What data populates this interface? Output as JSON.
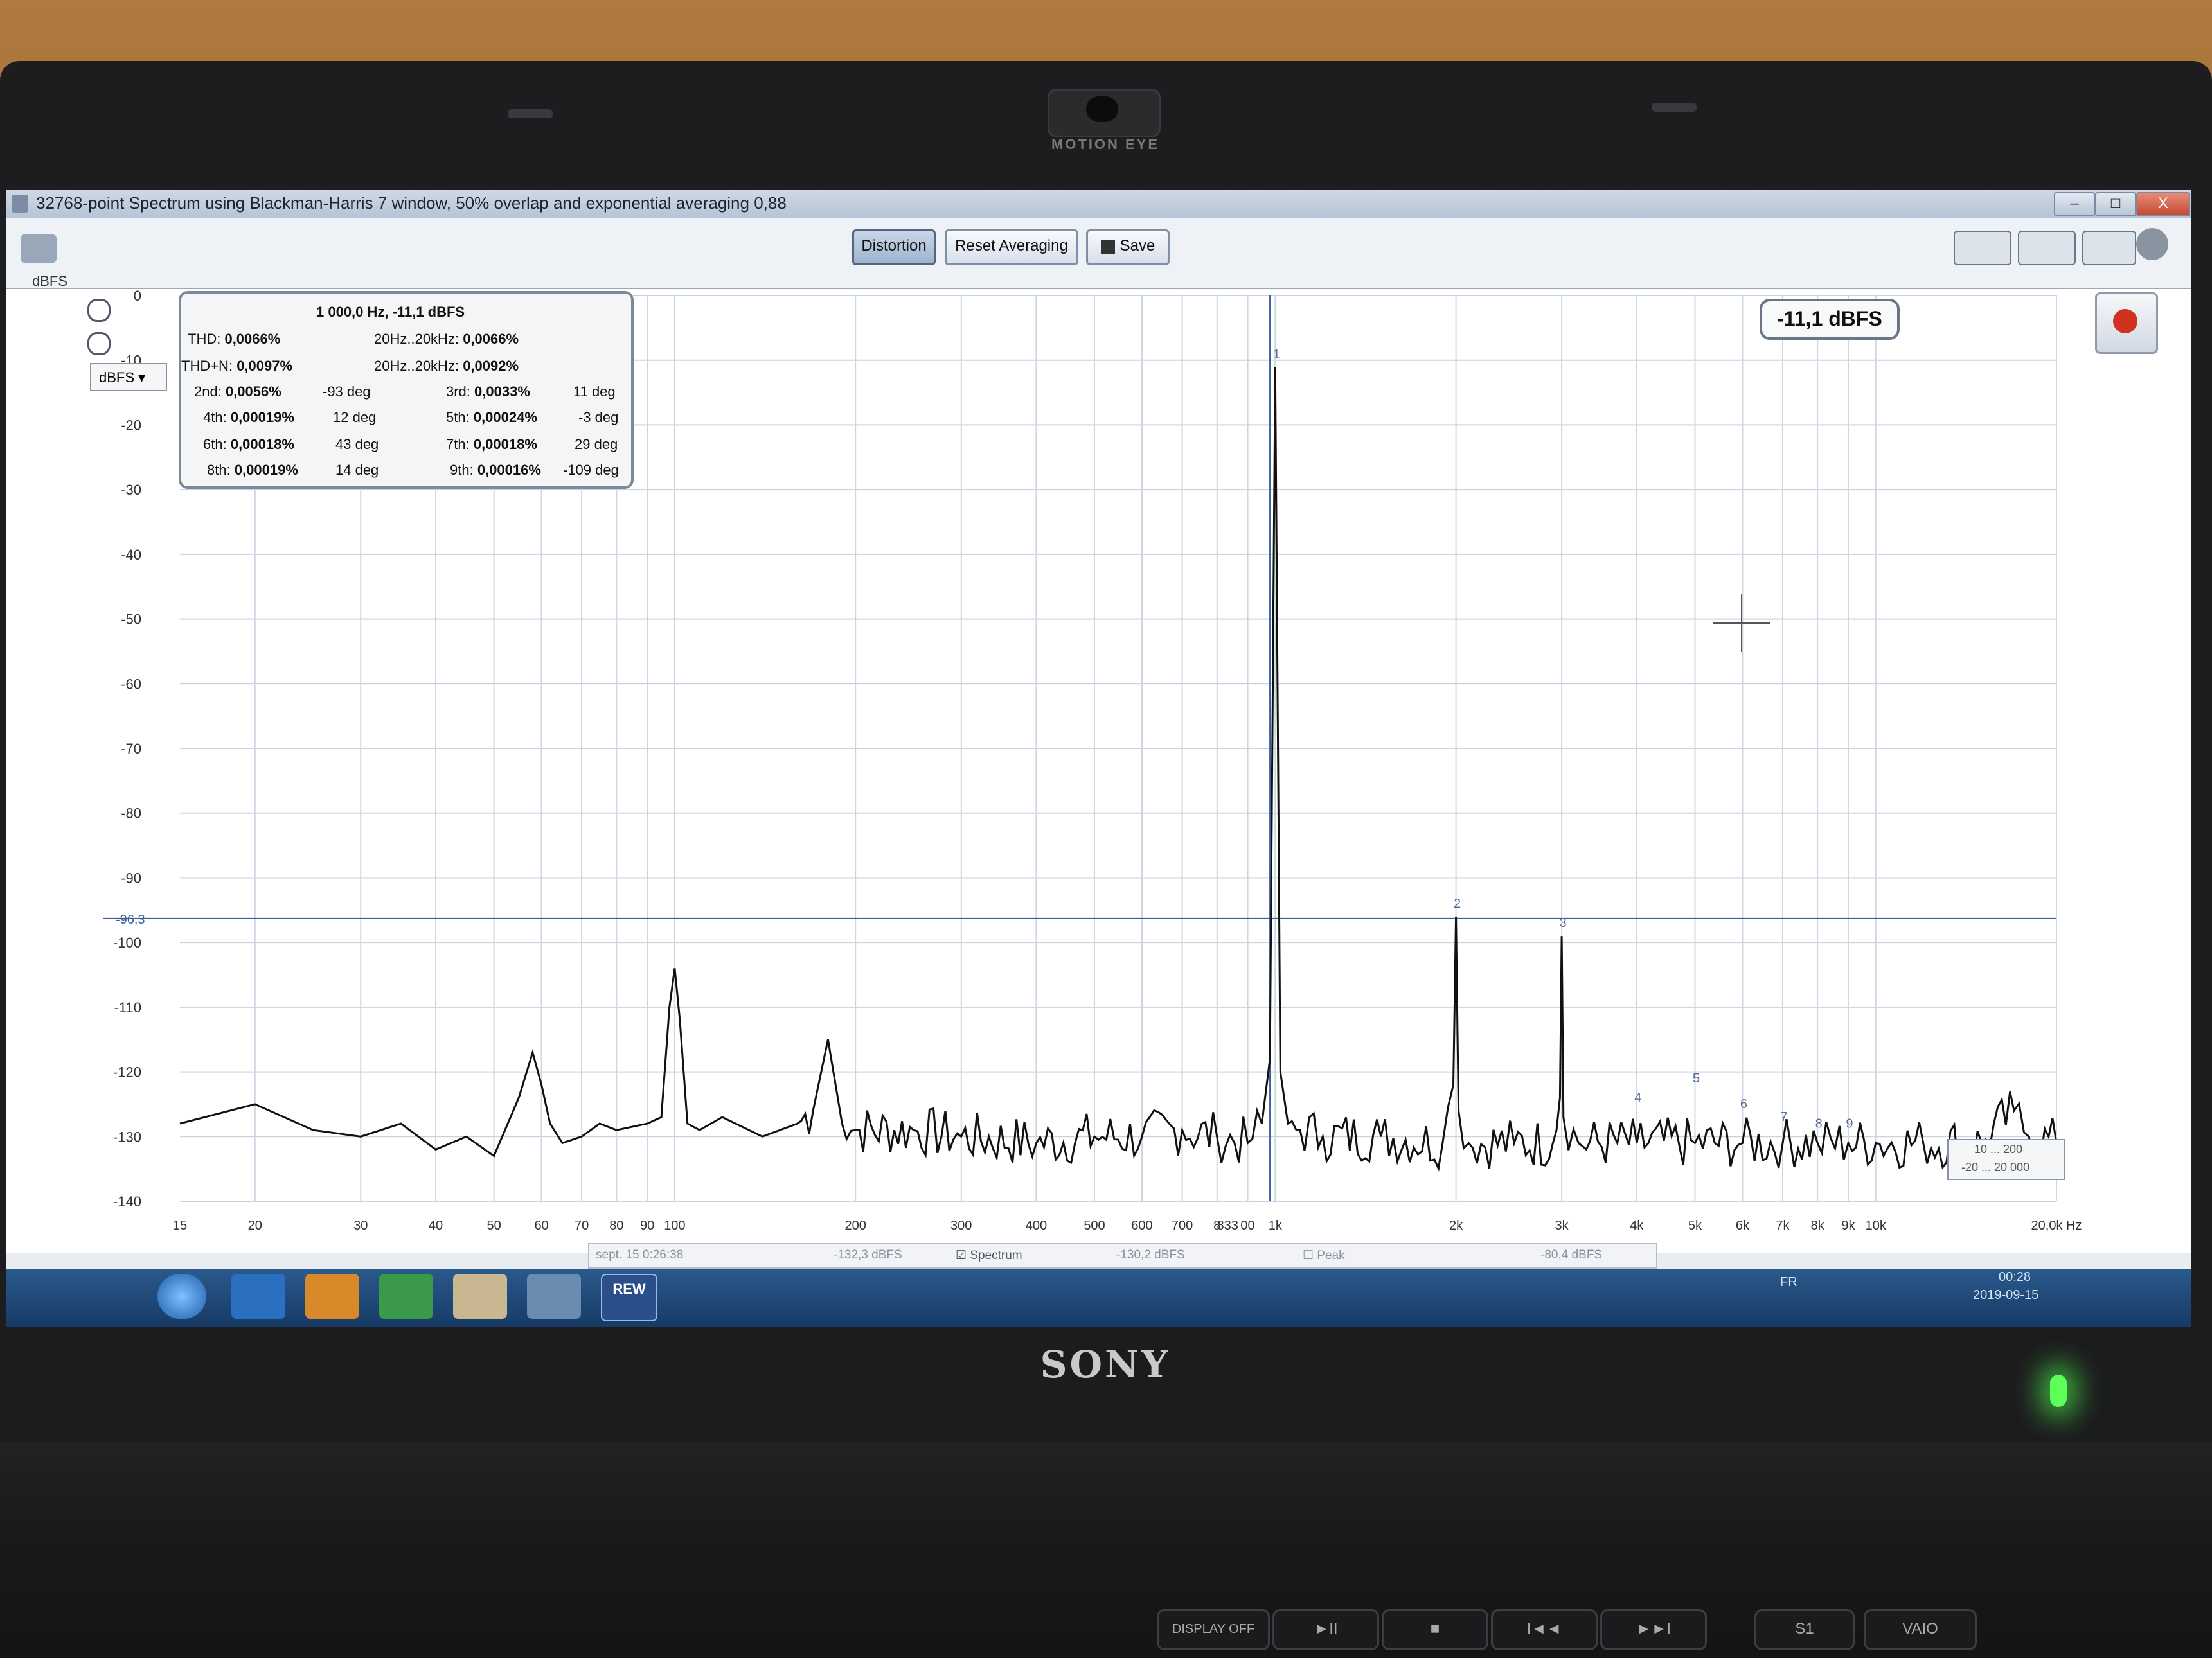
{
  "hardware": {
    "camera_label": "MOTION EYE",
    "brand": "SONY",
    "media_keys": [
      "DISPLAY OFF",
      "►II",
      "■",
      "I◄◄",
      "►►I",
      "S1",
      "VAIO"
    ]
  },
  "window": {
    "title": "32768-point Spectrum using Blackman-Harris 7 window, 50% overlap and exponential averaging 0,88",
    "minimize": "–",
    "maximize": "□",
    "close": "X"
  },
  "toolbar": {
    "distortion": "Distortion",
    "reset_averaging": "Reset Averaging",
    "save": "Save",
    "icons": [
      "screenshot-icon",
      "layout-icon",
      "columns-icon",
      "move-axes-icon",
      "gear-icon"
    ]
  },
  "plot": {
    "unit_label": "dBFS",
    "unit_select": "dBFS",
    "level_badge": "-11,1 dBFS",
    "cursor_marker_label": "-96,3",
    "y_ticks": [
      "0",
      "-10",
      "-20",
      "-30",
      "-40",
      "-50",
      "-60",
      "-70",
      "-80",
      "-90",
      "-100",
      "-110",
      "-120",
      "-130",
      "-140"
    ],
    "x_ticks": [
      "15",
      "20",
      "30",
      "40",
      "50",
      "60",
      "70",
      "80",
      "90",
      "100",
      "200",
      "300",
      "400",
      "500",
      "600",
      "700",
      "8",
      "833",
      "00",
      "1k",
      "2k",
      "3k",
      "4k",
      "5k",
      "6k",
      "7k",
      "8k",
      "9k",
      "10k",
      "20,0k Hz"
    ],
    "harmonic_markers": [
      "1",
      "2",
      "3",
      "4",
      "5",
      "6",
      "7",
      "8",
      "9"
    ],
    "range_box": [
      "10 ... 200",
      "-20 ... 20 000"
    ]
  },
  "distortion_panel": {
    "header": "1 000,0 Hz, -11,1 dBFS",
    "thd_label": "THD:",
    "thd": "0,0066%",
    "thd_band_label": "20Hz..20kHz:",
    "thd_band": "0,0066%",
    "thdn_label": "THD+N:",
    "thdn": "0,0097%",
    "thdn_band_label": "20Hz..20kHz:",
    "thdn_band": "0,0092%",
    "harmonics": [
      {
        "label": "2nd:",
        "value": "0,0056%",
        "phase": "-93 deg"
      },
      {
        "label": "3rd:",
        "value": "0,0033%",
        "phase": "11 deg"
      },
      {
        "label": "4th:",
        "value": "0,00019%",
        "phase": "12 deg"
      },
      {
        "label": "5th:",
        "value": "0,00024%",
        "phase": "-3 deg"
      },
      {
        "label": "6th:",
        "value": "0,00018%",
        "phase": "43 deg"
      },
      {
        "label": "7th:",
        "value": "0,00018%",
        "phase": "29 deg"
      },
      {
        "label": "8th:",
        "value": "0,00019%",
        "phase": "14 deg"
      },
      {
        "label": "9th:",
        "value": "0,00016%",
        "phase": "-109 deg"
      }
    ]
  },
  "legend": {
    "item1": "sept. 15 0:26:38",
    "item1_value": "-132,3 dBFS",
    "item2": "Spectrum",
    "item2_value": "-130,2 dBFS",
    "item3": "Peak",
    "item3_value": "-80,4 dBFS"
  },
  "taskbar": {
    "apps": [
      "start-orb",
      "ie-icon",
      "media-player-icon",
      "chrome-icon",
      "explorer-icon",
      "window-icon",
      "rew-icon"
    ],
    "rew_label": "REW",
    "lang": "FR",
    "time": "00:28",
    "date": "2019-09-15"
  },
  "chart_data": {
    "type": "line",
    "title": "",
    "xlabel": "Hz",
    "ylabel": "dBFS",
    "x_scale": "log",
    "xlim": [
      15,
      20000
    ],
    "ylim": [
      -140,
      0
    ],
    "grid": true,
    "series": [
      {
        "name": "Spectrum",
        "x": [
          15,
          20,
          25,
          30,
          35,
          40,
          45,
          50,
          55,
          58,
          60,
          62,
          65,
          70,
          75,
          80,
          90,
          95,
          98,
          100,
          102,
          105,
          110,
          120,
          140,
          160,
          170,
          180,
          190,
          200,
          250,
          300,
          400,
          500,
          600,
          700,
          800,
          900,
          950,
          980,
          1000,
          1020,
          1050,
          1100,
          1200,
          1500,
          1900,
          1980,
          2000,
          2020,
          2100,
          2500,
          2900,
          2980,
          3000,
          3020,
          3200,
          4000,
          5000,
          6000,
          7000,
          8000,
          9000,
          10000,
          12000,
          15000,
          17000,
          18000,
          20000
        ],
        "y": [
          -128,
          -125,
          -129,
          -130,
          -128,
          -132,
          -130,
          -133,
          -124,
          -117,
          -122,
          -128,
          -131,
          -130,
          -128,
          -129,
          -128,
          -127,
          -110,
          -104,
          -112,
          -128,
          -129,
          -127,
          -130,
          -128,
          -126,
          -115,
          -128,
          -129,
          -129,
          -130,
          -131,
          -130,
          -130,
          -129,
          -130,
          -131,
          -128,
          -118,
          -11.1,
          -120,
          -128,
          -129,
          -130,
          -130,
          -131,
          -122,
          -96,
          -126,
          -131,
          -131,
          -131,
          -124,
          -99,
          -127,
          -131,
          -131,
          -131,
          -131,
          -131,
          -131,
          -131,
          -131,
          -131,
          -131,
          -126,
          -130,
          -131
        ]
      }
    ]
  }
}
